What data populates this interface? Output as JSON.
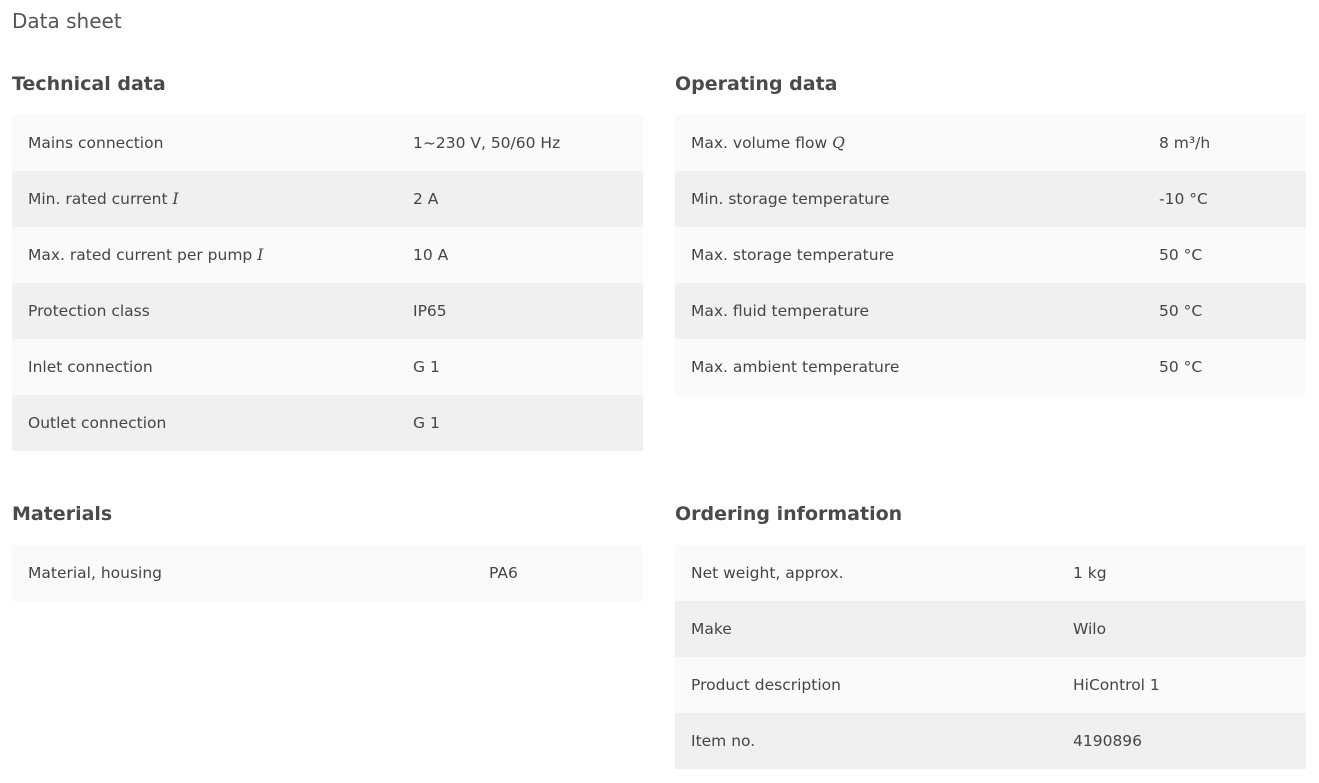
{
  "page": {
    "title": "Data sheet"
  },
  "technical": {
    "heading": "Technical data",
    "rows": [
      {
        "label": "Mains connection",
        "value": "1~230 V, 50/60 Hz"
      },
      {
        "label": "Min. rated current ",
        "symbol": "I",
        "value": "2 A"
      },
      {
        "label": "Max. rated current per pump ",
        "symbol": "I",
        "value": "10 A"
      },
      {
        "label": "Protection class",
        "value": "IP65"
      },
      {
        "label": "Inlet connection",
        "value": "G 1"
      },
      {
        "label": "Outlet connection",
        "value": "G 1"
      }
    ]
  },
  "operating": {
    "heading": "Operating data",
    "rows": [
      {
        "label": "Max. volume flow ",
        "symbol": "Q",
        "value": "8 m³/h"
      },
      {
        "label": "Min. storage temperature",
        "value": "-10 °C"
      },
      {
        "label": "Max. storage temperature",
        "value": "50 °C"
      },
      {
        "label": "Max. fluid temperature",
        "value": "50 °C"
      },
      {
        "label": "Max. ambient temperature",
        "value": "50 °C"
      }
    ]
  },
  "materials": {
    "heading": "Materials",
    "rows": [
      {
        "label": "Material, housing",
        "value": "PA6"
      }
    ]
  },
  "ordering": {
    "heading": "Ordering information",
    "rows": [
      {
        "label": "Net weight, approx.",
        "value": "1 kg"
      },
      {
        "label": "Make",
        "value": "Wilo"
      },
      {
        "label": "Product description",
        "value": "HiControl 1"
      },
      {
        "label": "Item no.",
        "value": "4190896"
      }
    ]
  }
}
